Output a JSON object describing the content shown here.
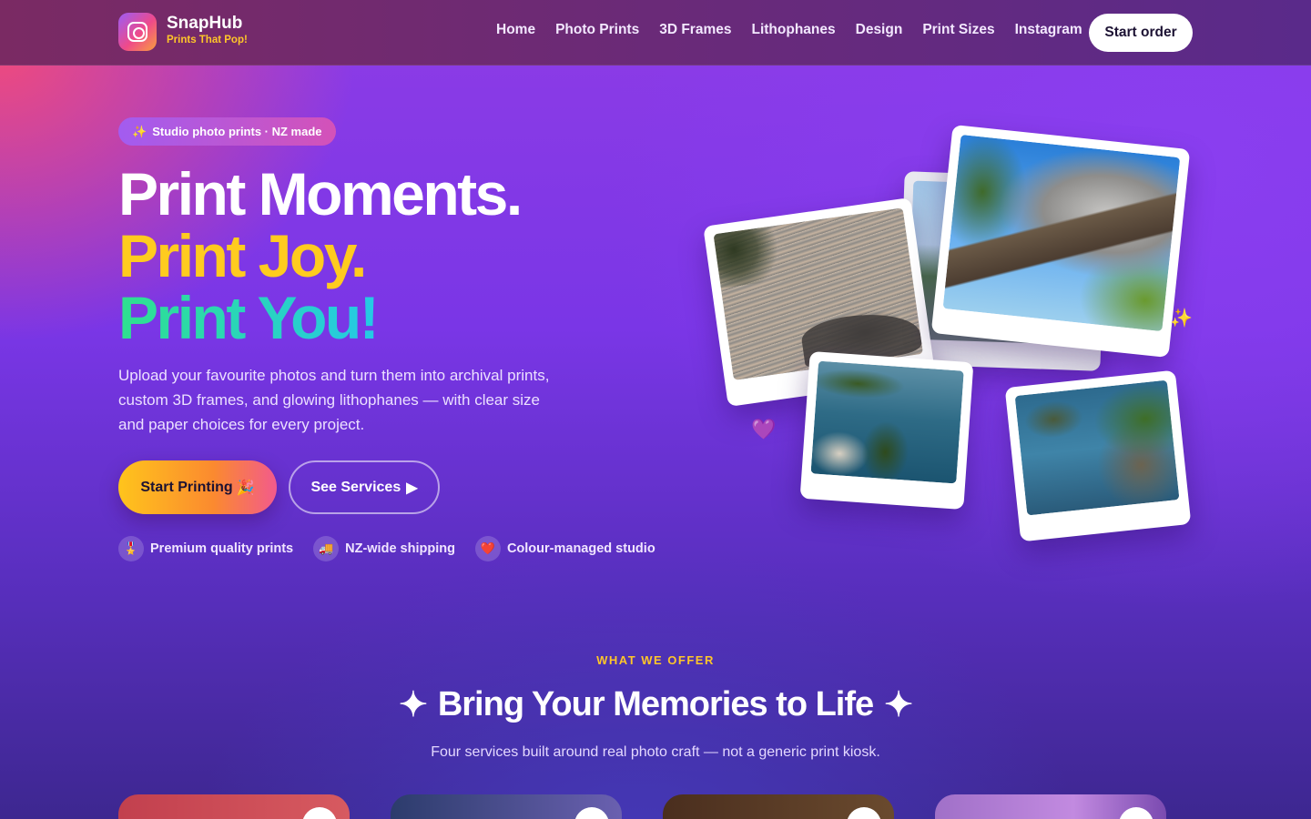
{
  "header": {
    "brand_name": "SnapHub",
    "brand_tagline": "Prints That Pop!",
    "nav": [
      "Home",
      "Photo Prints",
      "3D Frames",
      "Lithophanes",
      "Design",
      "Print Sizes",
      "Instagram"
    ],
    "cta": "Start order"
  },
  "hero": {
    "badge_icon": "✨",
    "badge_text": "Studio photo prints · NZ made",
    "headline_1": "Print Moments.",
    "headline_2": "Print Joy.",
    "headline_3": "Print You!",
    "lead": "Upload your favourite photos and turn them into archival prints, custom 3D frames, and glowing lithophanes — with clear size and paper choices for every project.",
    "primary_button": "Start Printing",
    "primary_button_icon": "🎉",
    "secondary_button": "See Services",
    "secondary_button_icon": "▶",
    "features": [
      {
        "icon": "🎖️",
        "label": "Premium quality prints"
      },
      {
        "icon": "🚚",
        "label": "NZ-wide shipping"
      },
      {
        "icon": "❤️",
        "label": "Colour-managed studio"
      }
    ],
    "decor": {
      "sparkle": "✨",
      "heart": "💜"
    }
  },
  "services": {
    "eyebrow": "WHAT WE OFFER",
    "title_decor": "✦",
    "title": "Bring Your Memories to Life",
    "subtitle": "Four services built around real photo craft — not a generic print kiosk."
  },
  "colors": {
    "accent_yellow": "#ffc629",
    "accent_teal": "#25c9e6",
    "purple_bg": "#7a36e6",
    "pink_glow": "#ee4a7e"
  }
}
